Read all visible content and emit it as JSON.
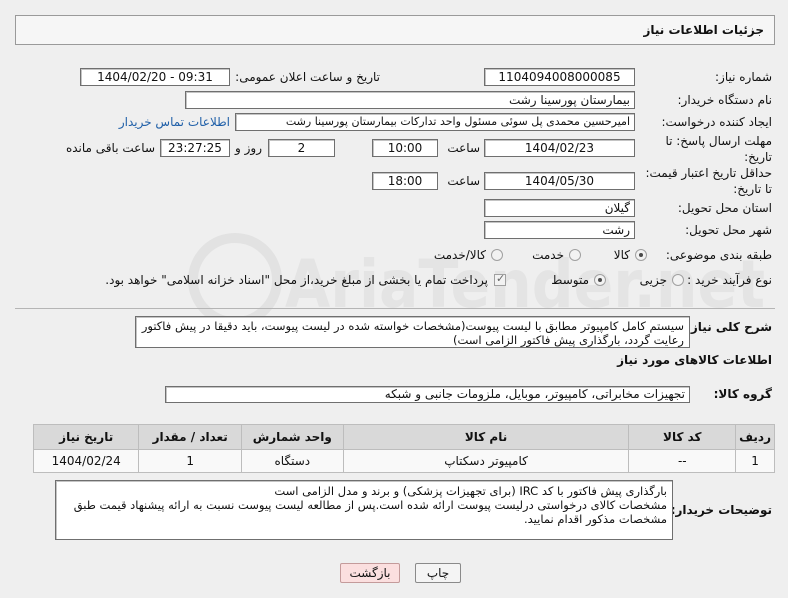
{
  "header": {
    "title": "جزئیات اطلاعات نیاز"
  },
  "need_number": {
    "label": "شماره نیاز:",
    "value": "1104094008000085"
  },
  "announce": {
    "label": "تاریخ و ساعت اعلان عمومی:",
    "value": "1404/02/20 - 09:31"
  },
  "buyer": {
    "label": "نام دستگاه خریدار:",
    "value": "بیمارستان پورسینا رشت"
  },
  "creator": {
    "label": "ایجاد کننده درخواست:",
    "value": "امیرحسین محمدی پل سوئی مسئول واحد تدارکات بیمارستان پورسینا رشت",
    "contact_link": "اطلاعات تماس خریدار"
  },
  "deadline": {
    "label_line1": "مهلت ارسال پاسخ: تا",
    "label_line2": "تاریخ:",
    "date": "1404/02/23",
    "time_label": "ساعت",
    "time": "10:00",
    "days": "2",
    "days_label": "روز و",
    "remaining": "23:27:25",
    "remaining_label": "ساعت باقی مانده"
  },
  "validity": {
    "label_line1": "حداقل تاریخ اعتبار قیمت:",
    "label_line2": "تا تاریخ:",
    "date": "1404/05/30",
    "time_label": "ساعت",
    "time": "18:00"
  },
  "province": {
    "label": "استان محل تحویل:",
    "value": "گیلان"
  },
  "city": {
    "label": "شهر محل تحویل:",
    "value": "رشت"
  },
  "category": {
    "label": "طبقه بندی موضوعی:",
    "options": [
      {
        "label": "کالا",
        "selected": true
      },
      {
        "label": "خدمت",
        "selected": false
      },
      {
        "label": "کالا/خدمت",
        "selected": false
      }
    ]
  },
  "process": {
    "label": "نوع فرآیند خرید :",
    "options": [
      {
        "label": "جزیی",
        "selected": false
      },
      {
        "label": "متوسط",
        "selected": true
      }
    ],
    "treasury_checked": true,
    "treasury_text": "پرداخت تمام یا بخشی از مبلغ خرید،از محل \"اسناد خزانه اسلامی\" خواهد بود."
  },
  "description": {
    "label": "شرح کلی نیاز:",
    "text": "سیستم کامل کامپیوتر مطابق با لیست پیوست(مشخصات خواسته شده در لیست پیوست، باید دقیقا در پیش فاکتور رعایت گردد، بارگذاری پیش فاکتور الزامی است)"
  },
  "goods_section": {
    "title": "اطلاعات کالاهای مورد نیاز"
  },
  "goods_group": {
    "label": "گروه کالا:",
    "value": "تجهیزات مخابراتی، کامپیوتر، موبایل، ملزومات جانبی و شبکه"
  },
  "table": {
    "headers": {
      "row": "ردیف",
      "code": "کد کالا",
      "name": "نام کالا",
      "unit": "واحد شمارش",
      "qty": "تعداد / مقدار",
      "date": "تاریخ نیاز"
    },
    "rows": [
      {
        "row": "1",
        "code": "--",
        "name": "کامپیوتر دسکتاپ",
        "unit": "دستگاه",
        "qty": "1",
        "date": "1404/02/24"
      }
    ]
  },
  "notes": {
    "label": "توضیحات خریدار:",
    "lines": [
      "بارگذاری پیش فاکتور با کد IRC (برای تجهیزات پزشکی) و برند و مدل الزامی است",
      "مشخصات کالای درخواستی درلیست پیوست ارائه شده است.پس از مطالعه لیست پیوست نسبت به ارائه پیشنهاد قیمت طبق مشخصات مذکور اقدام نمایید."
    ]
  },
  "buttons": {
    "print": "چاپ",
    "back": "بازگشت"
  },
  "watermark": "AriaTender.net",
  "colors": {
    "page_bg": "#efefef",
    "link": "#1f5fa8",
    "table_header_bg": "#d9d9d9",
    "back_button_bg": "#fbdfdf"
  }
}
